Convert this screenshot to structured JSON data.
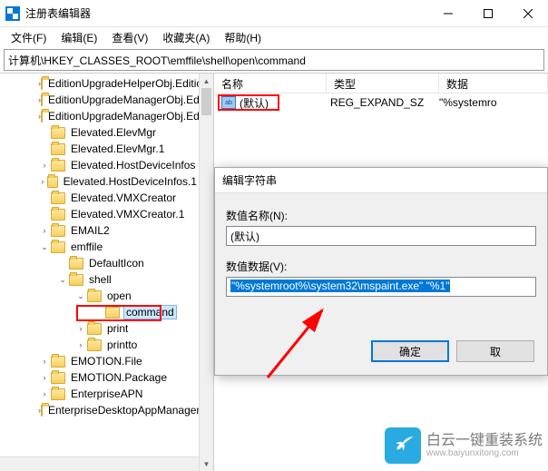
{
  "window": {
    "title": "注册表编辑器",
    "min_icon": "minimize-icon",
    "max_icon": "maximize-icon",
    "close_icon": "close-icon"
  },
  "menu": {
    "file": "文件(F)",
    "edit": "编辑(E)",
    "view": "查看(V)",
    "fav": "收藏夹(A)",
    "help": "帮助(H)"
  },
  "address": "计算机\\HKEY_CLASSES_ROOT\\emffile\\shell\\open\\command",
  "tree": [
    {
      "lvl": 2,
      "chev": ">",
      "label": "EditionUpgradeHelperObj.Editio"
    },
    {
      "lvl": 2,
      "chev": ">",
      "label": "EditionUpgradeManagerObj.Edi"
    },
    {
      "lvl": 2,
      "chev": ">",
      "label": "EditionUpgradeManagerObj.Edi"
    },
    {
      "lvl": 2,
      "chev": "",
      "label": "Elevated.ElevMgr"
    },
    {
      "lvl": 2,
      "chev": "",
      "label": "Elevated.ElevMgr.1"
    },
    {
      "lvl": 2,
      "chev": ">",
      "label": "Elevated.HostDeviceInfos"
    },
    {
      "lvl": 2,
      "chev": ">",
      "label": "Elevated.HostDeviceInfos.1"
    },
    {
      "lvl": 2,
      "chev": "",
      "label": "Elevated.VMXCreator"
    },
    {
      "lvl": 2,
      "chev": "",
      "label": "Elevated.VMXCreator.1"
    },
    {
      "lvl": 2,
      "chev": ">",
      "label": "EMAIL2"
    },
    {
      "lvl": 2,
      "chev": "v",
      "label": "emffile"
    },
    {
      "lvl": 3,
      "chev": "",
      "label": "DefaultIcon"
    },
    {
      "lvl": 3,
      "chev": "v",
      "label": "shell"
    },
    {
      "lvl": 4,
      "chev": "v",
      "label": "open"
    },
    {
      "lvl": 5,
      "chev": "",
      "label": "command",
      "selected": true
    },
    {
      "lvl": 4,
      "chev": ">",
      "label": "print"
    },
    {
      "lvl": 4,
      "chev": ">",
      "label": "printto"
    },
    {
      "lvl": 2,
      "chev": ">",
      "label": "EMOTION.File"
    },
    {
      "lvl": 2,
      "chev": ">",
      "label": "EMOTION.Package"
    },
    {
      "lvl": 2,
      "chev": ">",
      "label": "EnterpriseAPN"
    },
    {
      "lvl": 2,
      "chev": ">",
      "label": "EnterpriseDesktopAppManagem"
    }
  ],
  "columns": {
    "name": "名称",
    "type": "类型",
    "data": "数据"
  },
  "row": {
    "icon_text": "ab",
    "name": "(默认)",
    "type": "REG_EXPAND_SZ",
    "data": "\"%systemro"
  },
  "dialog": {
    "title": "编辑字符串",
    "name_label": "数值名称(N):",
    "name_value": "(默认)",
    "data_label": "数值数据(V):",
    "data_value": "\"%systemroot%\\system32\\mspaint.exe\" \"%1\"",
    "ok": "确定",
    "cancel": "取"
  },
  "watermark": {
    "brand": "白云一键重装系统",
    "url": "www.baiyunxitong.com"
  }
}
